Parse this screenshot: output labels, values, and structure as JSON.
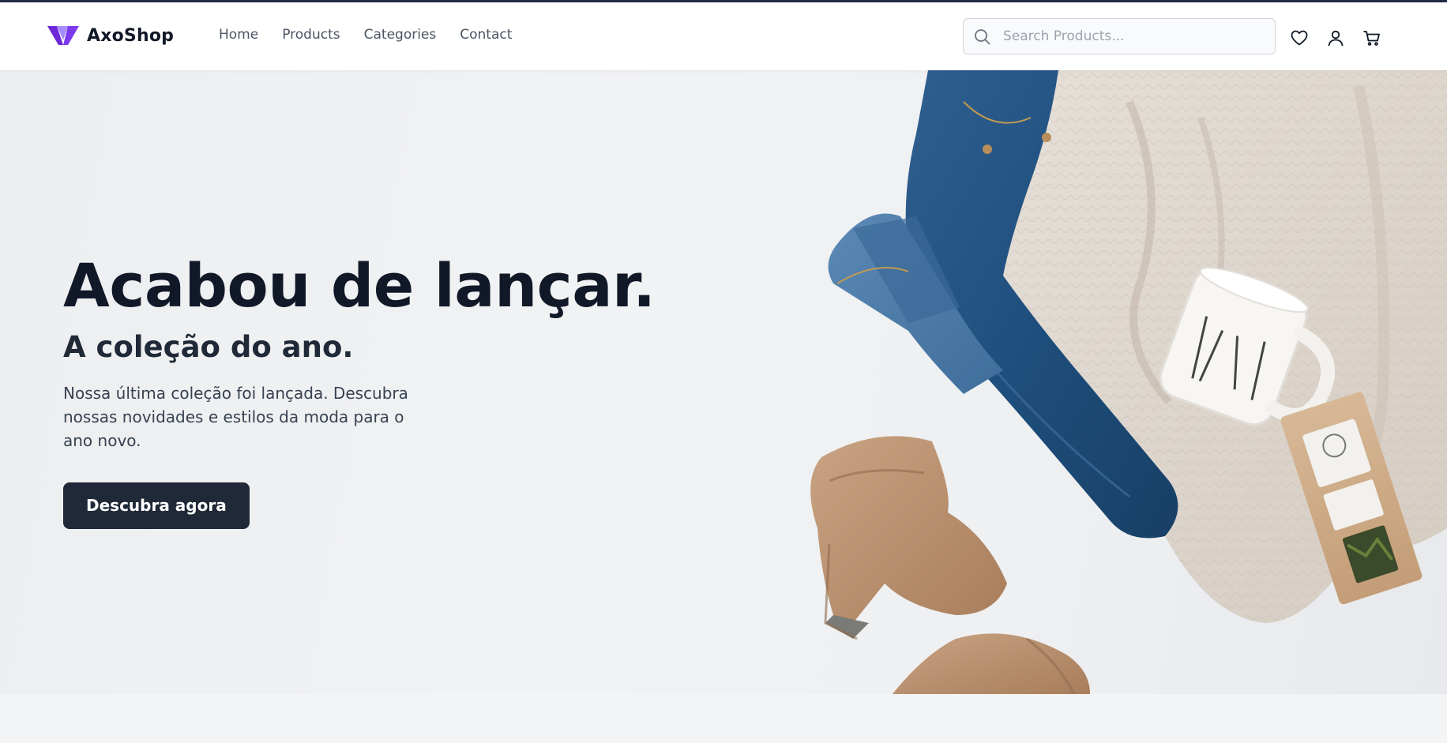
{
  "header": {
    "brand": "AxoShop",
    "nav": [
      "Home",
      "Products",
      "Categories",
      "Contact"
    ],
    "search_placeholder": "Search Products...",
    "icons": [
      "heart-icon",
      "user-icon",
      "cart-icon"
    ]
  },
  "hero": {
    "title": "Acabou de lançar.",
    "subtitle": "A coleção do ano.",
    "description": "Nossa última coleção foi lançada. Descubra nossas novidades e estilos da moda para o ano novo.",
    "cta": "Descubra agora"
  },
  "colors": {
    "accent": "#7c3aed",
    "button": "#1f2937",
    "heading": "#111827",
    "topline": "#1f2a44"
  }
}
